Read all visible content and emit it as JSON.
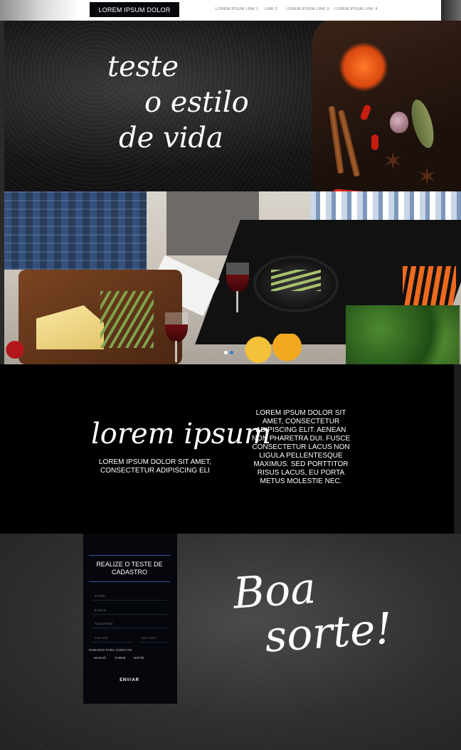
{
  "header": {
    "logo": "LOREM IPSUM DOLOR",
    "nav": [
      "LOREM IPSUM LINK 1",
      "LINK 2",
      "LOREM IPSUM LINK 3",
      "LOREM IPSUM LINK 4"
    ]
  },
  "hero": {
    "script_lines": [
      "teste",
      "o estilo",
      "de vida"
    ]
  },
  "carousel": {
    "slides": 2,
    "active_index": 1
  },
  "about": {
    "script_title": "lorem ipsum",
    "subtitle": "LOREM IPSUM DOLOR SIT AMET, CONSECTETUR ADIPISCING ELI",
    "paragraph": "LOREM IPSUM DOLOR SIT AMET, CONSECTETUR ADIPISCING ELIT. AENEAN NON PHARETRA DUI. FUSCE CONSECTETUR LACUS NON LIGULA PELLENTESQUE MAXIMUS. SED PORTTITOR RISUS LACUS, EU PORTA METUS MOLESTIE NEC."
  },
  "form": {
    "title": "REALIZE O TESTE DE CADASTRO",
    "fields": {
      "name": "NOME",
      "email": "E-MAIL",
      "phone": "TELEFONE",
      "city": "CIDADE",
      "state": "ESTADO"
    },
    "contact_time_label": "HORÁRIO PARA CONTATO:",
    "contact_options": [
      "MANHÃ",
      "TARDE",
      "NOITE"
    ],
    "submit_label": "ENVIAR"
  },
  "closing": {
    "script_lines": [
      "Boa",
      "sorte!"
    ]
  },
  "colors": {
    "form_bg": "#05070d",
    "accent_line": "#2f5ba0",
    "dot_active": "#3a7bd5"
  }
}
